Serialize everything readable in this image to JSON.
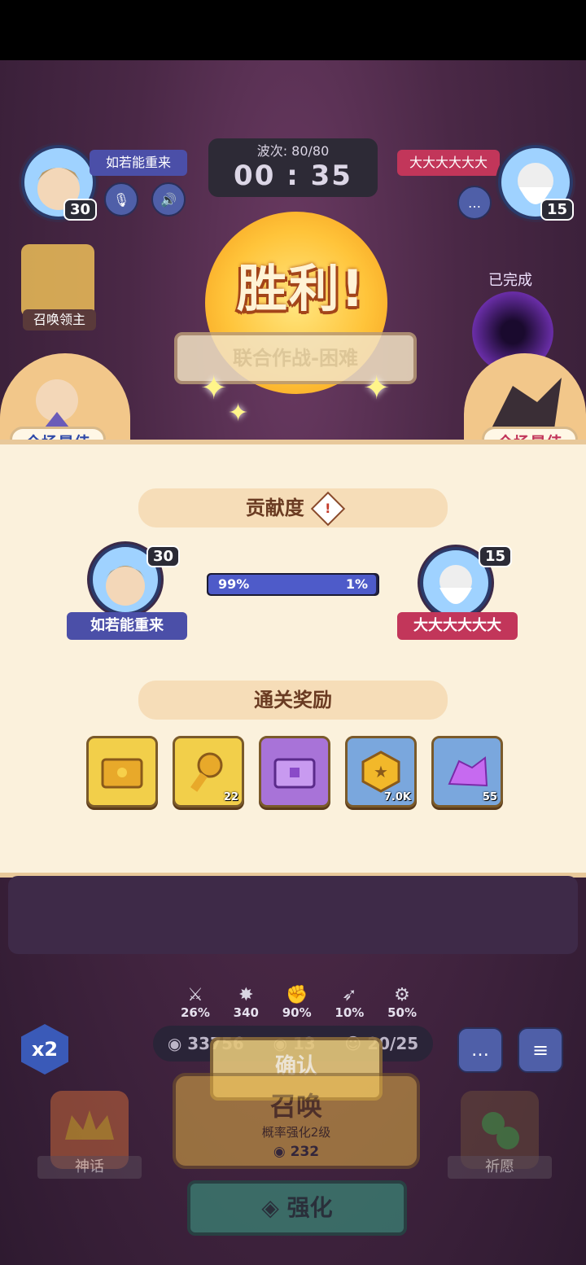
{
  "header": {
    "player_left": {
      "name": "如若能重来",
      "level": "30"
    },
    "player_right": {
      "name": "大大大大大大",
      "level": "15"
    },
    "wave_label": "波次: 80/80",
    "timer": "00 : 35",
    "boss_status": "已完成",
    "summon_lord_label": "召唤领主"
  },
  "victory": {
    "title": "胜利!",
    "banner": "联合作战-困难",
    "best_left": "全场最佳",
    "best_right": "全场最佳"
  },
  "contribution": {
    "title": "贡献度",
    "left_percent": "99%",
    "right_percent": "1%",
    "left_fraction": 0.99,
    "left_player": {
      "name": "如若能重来",
      "level": "30"
    },
    "right_player": {
      "name": "大大大大大大",
      "level": "15"
    }
  },
  "rewards": {
    "title": "通关奖励",
    "items": [
      {
        "icon": "gold-chest-icon",
        "count": "",
        "bg": "#f2cf4a"
      },
      {
        "icon": "star-key-icon",
        "count": "22",
        "bg": "#f2cf4a"
      },
      {
        "icon": "purple-chest-icon",
        "count": "",
        "bg": "#a873d8"
      },
      {
        "icon": "gold-coin-icon",
        "count": "7.0K",
        "bg": "#7aa7dd"
      },
      {
        "icon": "purple-crystal-icon",
        "count": "55",
        "bg": "#7aa7dd"
      }
    ]
  },
  "confirm_label": "确认",
  "bottom": {
    "stats": [
      "26%",
      "340",
      "90%",
      "10%",
      "50%"
    ],
    "resources": {
      "silver": "33756",
      "coin": "13",
      "units": "20/25"
    },
    "speed_label": "x2",
    "summon": {
      "title": "召唤",
      "subtitle": "概率强化2级",
      "cost": "232"
    },
    "myth_label": "神话",
    "wish_label": "祈愿",
    "upgrade_label": "强化"
  }
}
